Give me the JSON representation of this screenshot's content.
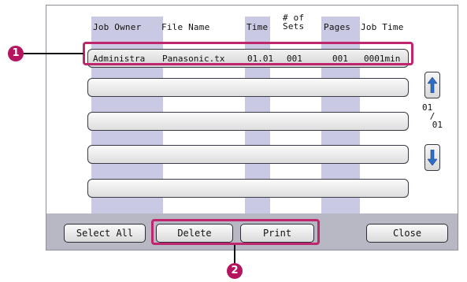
{
  "columns": {
    "job_owner": "Job Owner",
    "file_name": "File Name",
    "time": "Time",
    "sets_line1": "# of",
    "sets_line2": "Sets",
    "pages": "Pages",
    "job_time": "Job Time"
  },
  "jobs": [
    {
      "owner": "Administra",
      "file": "Panasonic.tx",
      "time": "01.01",
      "sets": "001",
      "pages": "001",
      "job_time": "0001min"
    }
  ],
  "empty_rows": 4,
  "page_indicator": {
    "current": "01",
    "separator": "/",
    "total": "01"
  },
  "buttons": {
    "select_all": "Select All",
    "delete": "Delete",
    "print": "Print",
    "close": "Close"
  },
  "callouts": {
    "first": "1",
    "second": "2"
  },
  "icons": {
    "scroll_up": "up-arrow-icon",
    "scroll_down": "down-arrow-icon"
  },
  "colors": {
    "panel": "#b8b8c4",
    "column_band": "#c9c9e3",
    "callout": "#c0266e",
    "arrow": "#2f6ec6"
  }
}
